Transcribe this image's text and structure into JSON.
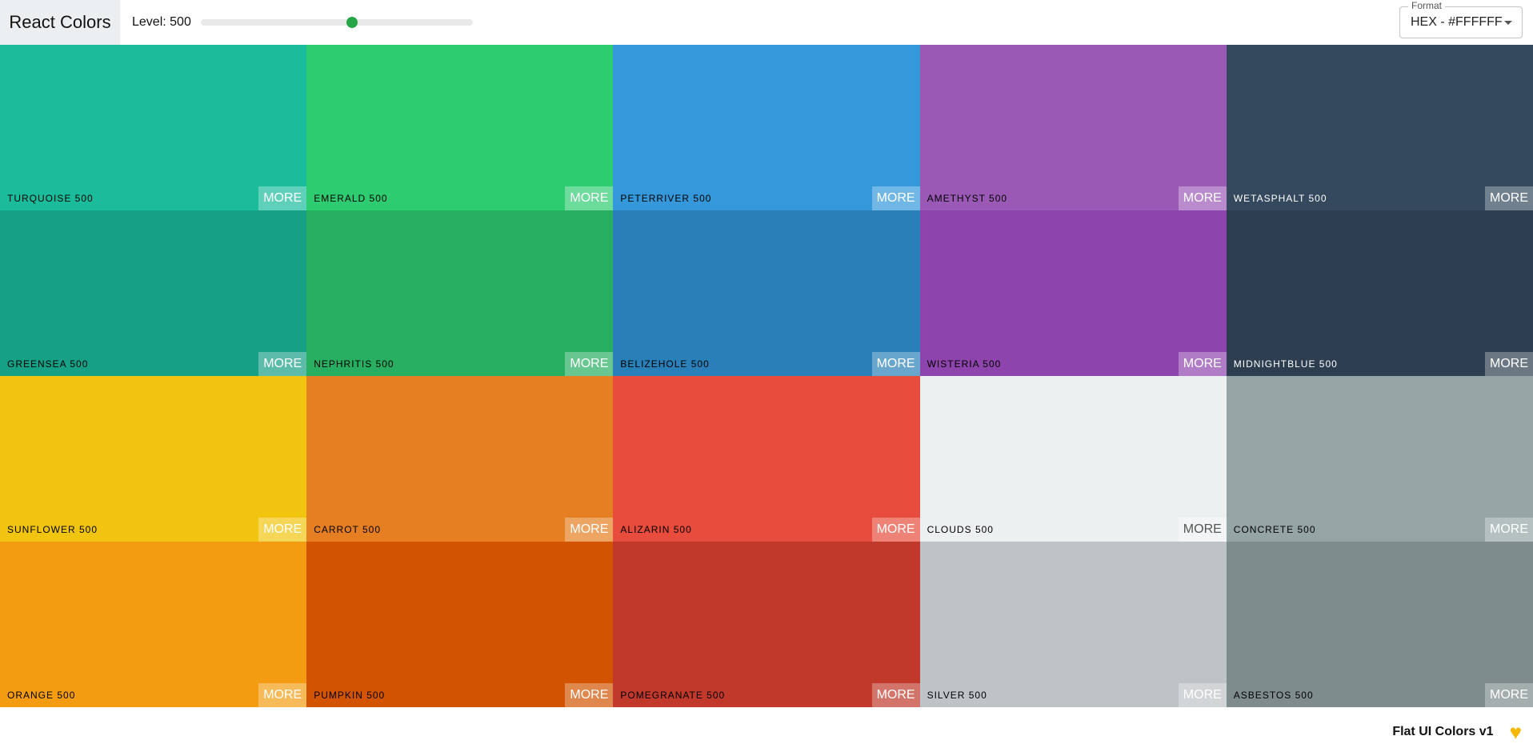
{
  "navbar": {
    "logo": "React Colors",
    "level_label": "Level: 500",
    "level_value": 500,
    "level_max": 900,
    "format_legend": "Format",
    "format_value": "HEX - #FFFFFF"
  },
  "colors": [
    {
      "name": "TURQUOISE 500",
      "hex": "#1abc9c",
      "more": "MORE"
    },
    {
      "name": "EMERALD 500",
      "hex": "#2ecc71",
      "more": "MORE"
    },
    {
      "name": "PETERRIVER 500",
      "hex": "#3498db",
      "more": "MORE"
    },
    {
      "name": "AMETHYST 500",
      "hex": "#9b59b6",
      "more": "MORE"
    },
    {
      "name": "WETASPHALT 500",
      "hex": "#34495e",
      "more": "MORE"
    },
    {
      "name": "GREENSEA 500",
      "hex": "#16a085",
      "more": "MORE"
    },
    {
      "name": "NEPHRITIS 500",
      "hex": "#27ae60",
      "more": "MORE"
    },
    {
      "name": "BELIZEHOLE 500",
      "hex": "#2980b9",
      "more": "MORE"
    },
    {
      "name": "WISTERIA 500",
      "hex": "#8e44ad",
      "more": "MORE"
    },
    {
      "name": "MIDNIGHTBLUE 500",
      "hex": "#2c3e50",
      "more": "MORE"
    },
    {
      "name": "SUNFLOWER 500",
      "hex": "#f1c40f",
      "more": "MORE"
    },
    {
      "name": "CARROT 500",
      "hex": "#e67e22",
      "more": "MORE"
    },
    {
      "name": "ALIZARIN 500",
      "hex": "#e74c3c",
      "more": "MORE"
    },
    {
      "name": "CLOUDS 500",
      "hex": "#ecf0f1",
      "more": "MORE"
    },
    {
      "name": "CONCRETE 500",
      "hex": "#95a5a6",
      "more": "MORE"
    },
    {
      "name": "ORANGE 500",
      "hex": "#f39c12",
      "more": "MORE"
    },
    {
      "name": "PUMPKIN 500",
      "hex": "#d35400",
      "more": "MORE"
    },
    {
      "name": "POMEGRANATE 500",
      "hex": "#c0392b",
      "more": "MORE"
    },
    {
      "name": "SILVER 500",
      "hex": "#bdc3c7",
      "more": "MORE"
    },
    {
      "name": "ASBESTOS 500",
      "hex": "#7f8c8d",
      "more": "MORE"
    }
  ],
  "footer": {
    "text": "Flat UI Colors v1",
    "icon": "heart-icon"
  }
}
